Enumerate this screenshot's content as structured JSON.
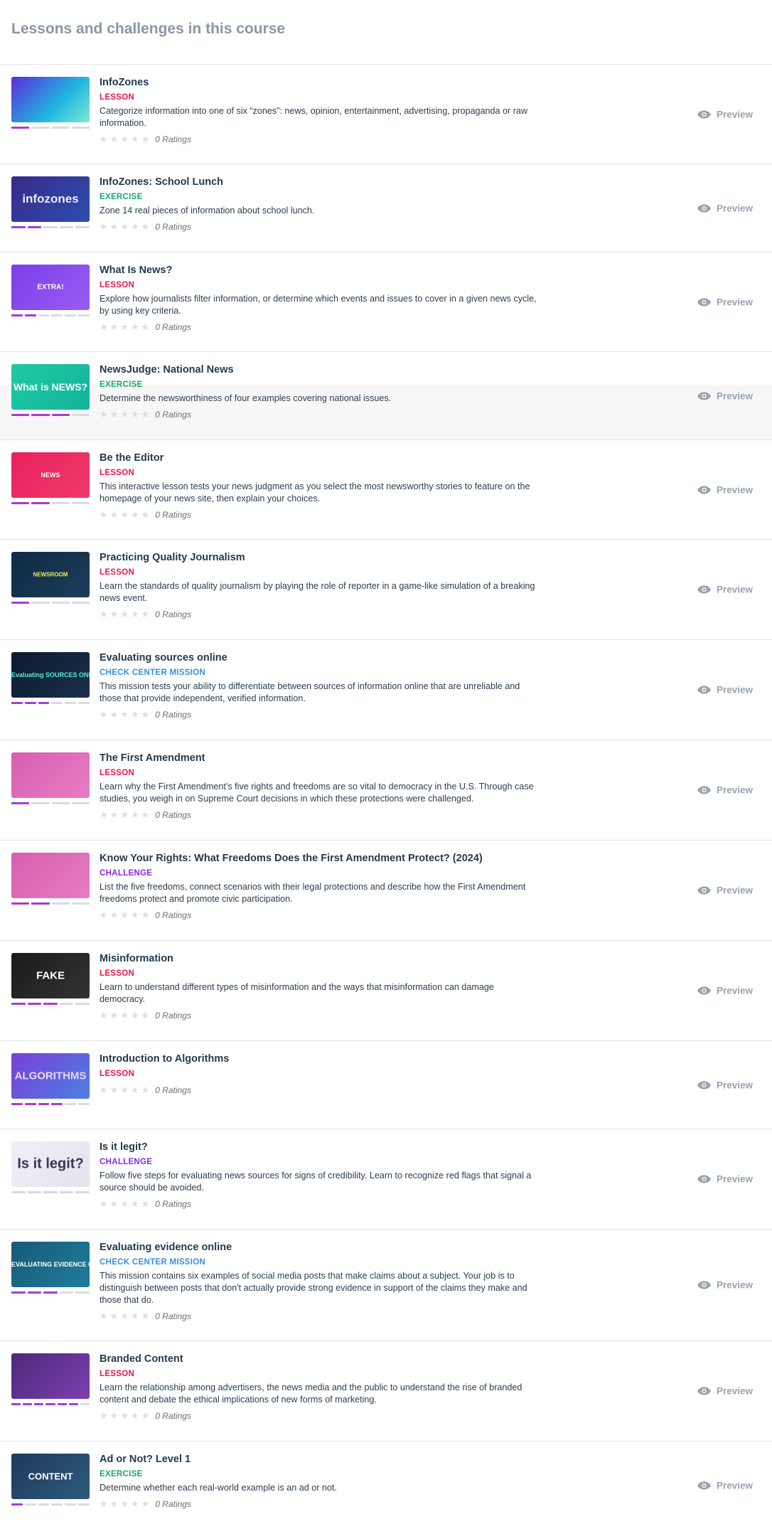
{
  "heading": "Lessons and challenges in this course",
  "preview_label": "Preview",
  "colors": {
    "lesson": "#e5194d",
    "exercise": "#17a873",
    "mission": "#3a8fd9",
    "challenge": "#8a2ae0",
    "progress": "#a63bd9"
  },
  "items": [
    {
      "title": "InfoZones",
      "type": "LESSON",
      "kind": "lesson",
      "description": "Categorize information into one of six “zones”: news, opinion, entertainment, advertising, propaganda or raw information.",
      "ratings": "0 Ratings",
      "progress_done": 1,
      "progress_segments": 4,
      "thumb_text": ""
    },
    {
      "title": "InfoZones: School Lunch",
      "type": "EXERCISE",
      "kind": "exercise",
      "description": "Zone 14 real pieces of information about school lunch.",
      "ratings": "0 Ratings",
      "progress_done": 2,
      "progress_segments": 5,
      "thumb_text": "infozones"
    },
    {
      "title": "What Is News?",
      "type": "LESSON",
      "kind": "lesson",
      "description": "Explore how journalists filter information, or determine which events and issues to cover in a given news cycle, by using key criteria.",
      "ratings": "0 Ratings",
      "progress_done": 2,
      "progress_segments": 6,
      "thumb_text": "EXTRA!"
    },
    {
      "title": "NewsJudge: National News",
      "type": "EXERCISE",
      "kind": "exercise",
      "description": "Determine the newsworthiness of four examples covering national issues.",
      "ratings": "0 Ratings",
      "progress_done": 3,
      "progress_segments": 4,
      "thumb_text": "What is NEWS?"
    },
    {
      "title": "Be the Editor",
      "type": "LESSON",
      "kind": "lesson",
      "description": "This interactive lesson tests your news judgment as you select the most newsworthy stories to feature on the homepage of your news site, then explain your choices.",
      "ratings": "0 Ratings",
      "progress_done": 2,
      "progress_segments": 4,
      "thumb_text": "NEWS"
    },
    {
      "title": "Practicing Quality Journalism",
      "type": "LESSON",
      "kind": "lesson",
      "description": "Learn the standards of quality journalism by playing the role of reporter in a game-like simulation of a breaking news event.",
      "ratings": "0 Ratings",
      "progress_done": 1,
      "progress_segments": 4,
      "thumb_text": "NEWSROOM"
    },
    {
      "title": "Evaluating sources online",
      "type": "CHECK CENTER MISSION",
      "kind": "mission",
      "description": "This mission tests your ability to differentiate between sources of information online that are unreliable and those that provide independent, verified information.",
      "ratings": "0 Ratings",
      "progress_done": 3,
      "progress_segments": 6,
      "thumb_text": "Evaluating SOURCES ONLINE"
    },
    {
      "title": "The First Amendment",
      "type": "LESSON",
      "kind": "lesson",
      "description": "Learn why the First Amendment’s five rights and freedoms are so vital to democracy in the U.S. Through case studies, you weigh in on Supreme Court decisions in which these protections were challenged.",
      "ratings": "0 Ratings",
      "progress_done": 1,
      "progress_segments": 4,
      "thumb_text": ""
    },
    {
      "title": "Know Your Rights: What Freedoms Does the First Amendment Protect? (2024)",
      "type": "CHALLENGE",
      "kind": "challenge",
      "description": "List the five freedoms, connect scenarios with their legal protections and describe how the First Amendment freedoms protect and promote civic participation.",
      "ratings": "0 Ratings",
      "progress_done": 2,
      "progress_segments": 4,
      "thumb_text": ""
    },
    {
      "title": "Misinformation",
      "type": "LESSON",
      "kind": "lesson",
      "description": "Learn to understand different types of misinformation and the ways that misinformation can damage democracy.",
      "ratings": "0 Ratings",
      "progress_done": 3,
      "progress_segments": 5,
      "thumb_text": "FAKE"
    },
    {
      "title": "Introduction to Algorithms",
      "type": "LESSON",
      "kind": "lesson",
      "description": "",
      "ratings": "0 Ratings",
      "progress_done": 4,
      "progress_segments": 6,
      "thumb_text": "ALGORITHMS"
    },
    {
      "title": "Is it legit?",
      "type": "CHALLENGE",
      "kind": "challenge",
      "description": "Follow five steps for evaluating news sources for signs of credibility. Learn to recognize red flags that signal a source should be avoided.",
      "ratings": "0 Ratings",
      "progress_done": 0,
      "progress_segments": 5,
      "thumb_text": "Is it legit?"
    },
    {
      "title": "Evaluating evidence online",
      "type": "CHECK CENTER MISSION",
      "kind": "mission",
      "description": "This mission contains six examples of social media posts that make claims about a subject. Your job is to distinguish between posts that don't actually provide strong evidence in support of the claims they make and those that do.",
      "ratings": "0 Ratings",
      "progress_done": 3,
      "progress_segments": 5,
      "thumb_text": "EVALUATING EVIDENCE ONLINE"
    },
    {
      "title": "Branded Content",
      "type": "LESSON",
      "kind": "lesson",
      "description": "Learn the relationship among advertisers, the news media and the public to understand the rise of branded content and debate the ethical implications of new forms of marketing.",
      "ratings": "0 Ratings",
      "progress_done": 6,
      "progress_segments": 7,
      "thumb_text": ""
    },
    {
      "title": "Ad or Not? Level 1",
      "type": "EXERCISE",
      "kind": "exercise",
      "description": "Determine whether each real-world example is an ad or not.",
      "ratings": "0 Ratings",
      "progress_done": 1,
      "progress_segments": 6,
      "thumb_text": "CONTENT"
    }
  ]
}
